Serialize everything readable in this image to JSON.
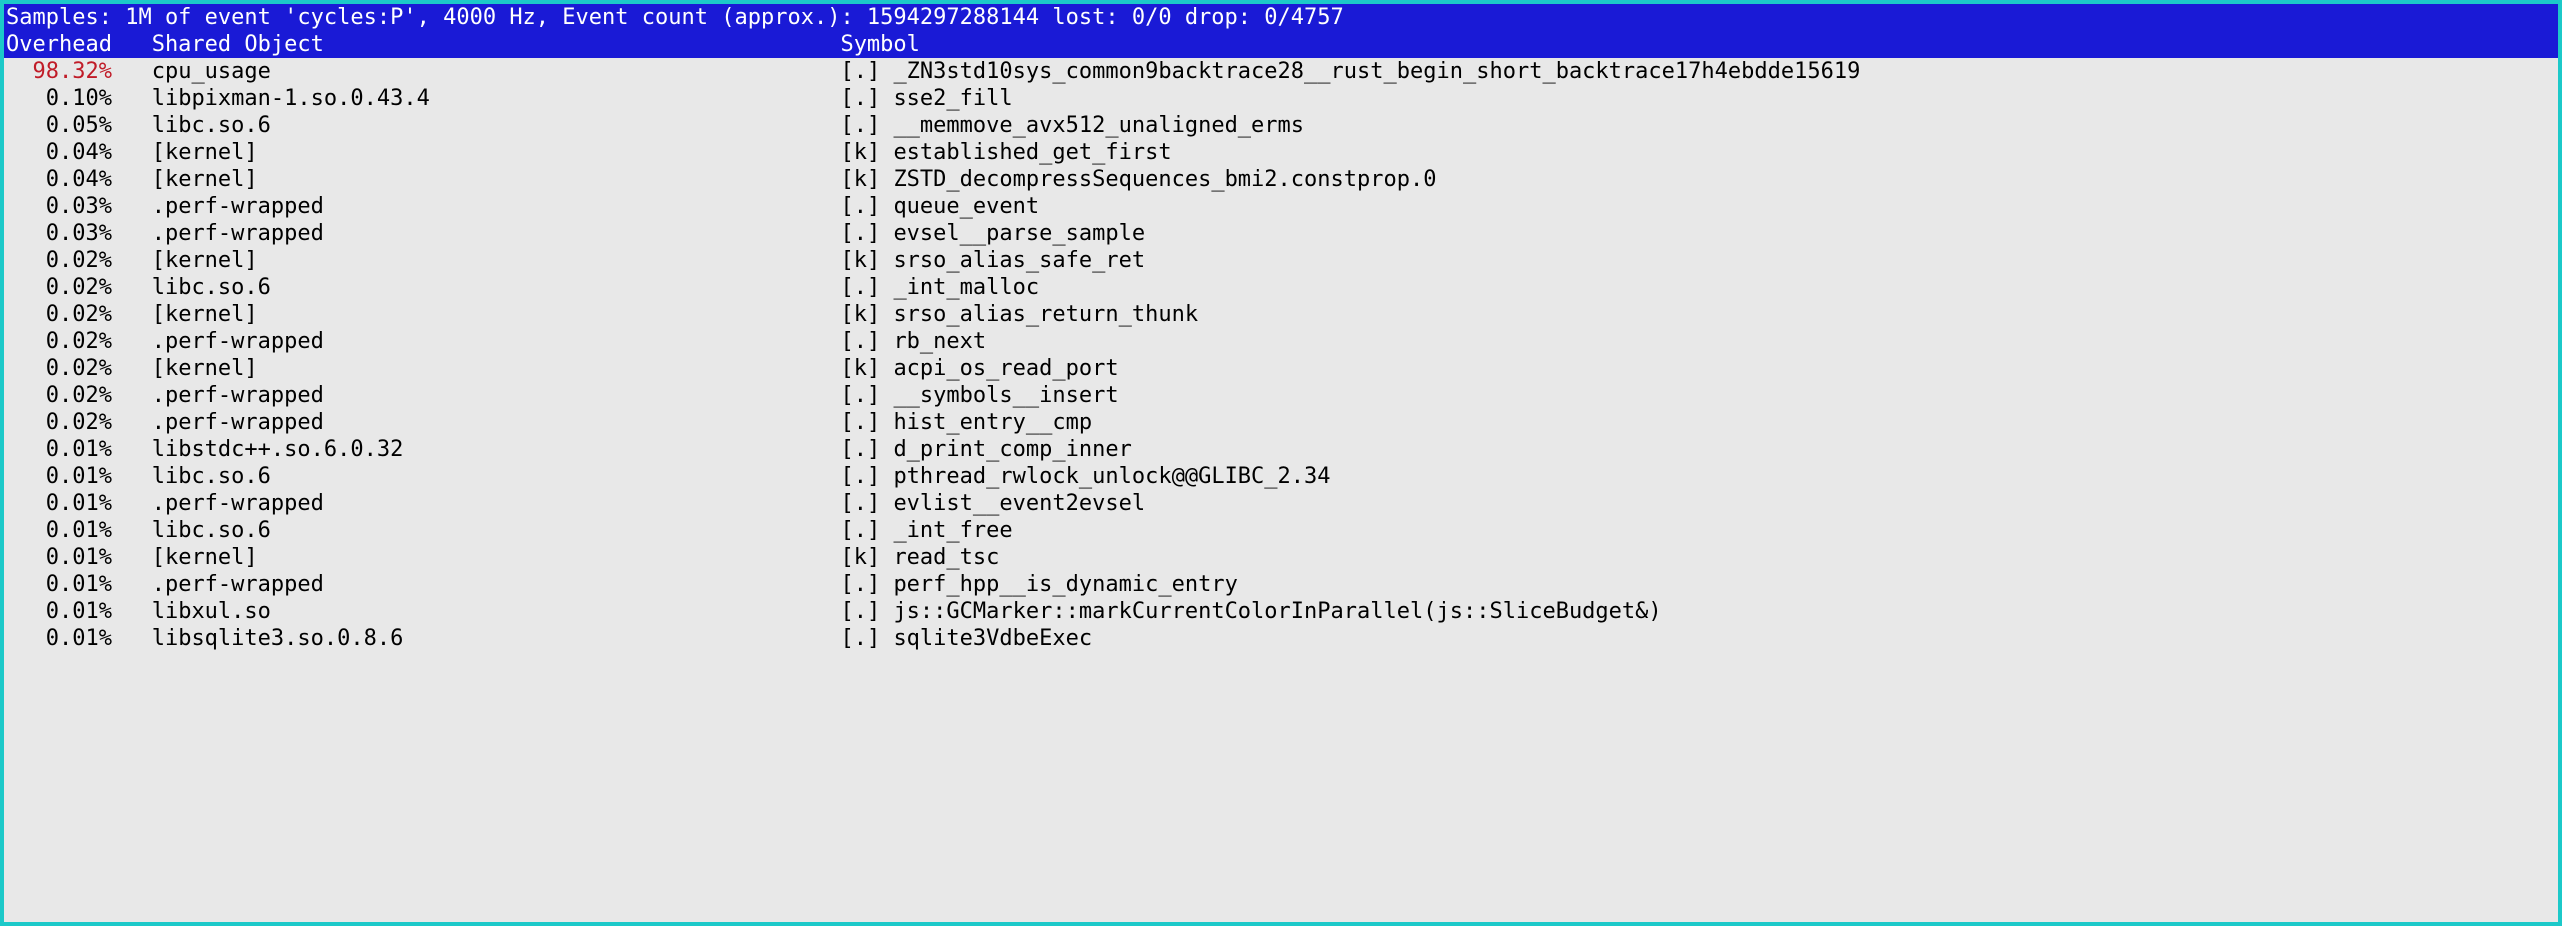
{
  "header": {
    "samples_line": "Samples: 1M of event 'cycles:P', 4000 Hz, Event count (approx.): 1594297288144 lost: 0/0 drop: 0/4757",
    "col_overhead": "Overhead",
    "col_shared": "Shared Object",
    "col_symbol": "Symbol"
  },
  "rows": [
    {
      "overhead": "98.32%",
      "hot": true,
      "shared": "cpu_usage",
      "tag": "[.]",
      "symbol": "_ZN3std10sys_common9backtrace28__rust_begin_short_backtrace17h4ebdde15619"
    },
    {
      "overhead": "0.10%",
      "hot": false,
      "shared": "libpixman-1.so.0.43.4",
      "tag": "[.]",
      "symbol": "sse2_fill"
    },
    {
      "overhead": "0.05%",
      "hot": false,
      "shared": "libc.so.6",
      "tag": "[.]",
      "symbol": "__memmove_avx512_unaligned_erms"
    },
    {
      "overhead": "0.04%",
      "hot": false,
      "shared": "[kernel]",
      "tag": "[k]",
      "symbol": "established_get_first"
    },
    {
      "overhead": "0.04%",
      "hot": false,
      "shared": "[kernel]",
      "tag": "[k]",
      "symbol": "ZSTD_decompressSequences_bmi2.constprop.0"
    },
    {
      "overhead": "0.03%",
      "hot": false,
      "shared": ".perf-wrapped",
      "tag": "[.]",
      "symbol": "queue_event"
    },
    {
      "overhead": "0.03%",
      "hot": false,
      "shared": ".perf-wrapped",
      "tag": "[.]",
      "symbol": "evsel__parse_sample"
    },
    {
      "overhead": "0.02%",
      "hot": false,
      "shared": "[kernel]",
      "tag": "[k]",
      "symbol": "srso_alias_safe_ret"
    },
    {
      "overhead": "0.02%",
      "hot": false,
      "shared": "libc.so.6",
      "tag": "[.]",
      "symbol": "_int_malloc"
    },
    {
      "overhead": "0.02%",
      "hot": false,
      "shared": "[kernel]",
      "tag": "[k]",
      "symbol": "srso_alias_return_thunk"
    },
    {
      "overhead": "0.02%",
      "hot": false,
      "shared": ".perf-wrapped",
      "tag": "[.]",
      "symbol": "rb_next"
    },
    {
      "overhead": "0.02%",
      "hot": false,
      "shared": "[kernel]",
      "tag": "[k]",
      "symbol": "acpi_os_read_port"
    },
    {
      "overhead": "0.02%",
      "hot": false,
      "shared": ".perf-wrapped",
      "tag": "[.]",
      "symbol": "__symbols__insert"
    },
    {
      "overhead": "0.02%",
      "hot": false,
      "shared": ".perf-wrapped",
      "tag": "[.]",
      "symbol": "hist_entry__cmp"
    },
    {
      "overhead": "0.01%",
      "hot": false,
      "shared": "libstdc++.so.6.0.32",
      "tag": "[.]",
      "symbol": "d_print_comp_inner"
    },
    {
      "overhead": "0.01%",
      "hot": false,
      "shared": "libc.so.6",
      "tag": "[.]",
      "symbol": "pthread_rwlock_unlock@@GLIBC_2.34"
    },
    {
      "overhead": "0.01%",
      "hot": false,
      "shared": ".perf-wrapped",
      "tag": "[.]",
      "symbol": "evlist__event2evsel"
    },
    {
      "overhead": "0.01%",
      "hot": false,
      "shared": "libc.so.6",
      "tag": "[.]",
      "symbol": "_int_free"
    },
    {
      "overhead": "0.01%",
      "hot": false,
      "shared": "[kernel]",
      "tag": "[k]",
      "symbol": "read_tsc"
    },
    {
      "overhead": "0.01%",
      "hot": false,
      "shared": ".perf-wrapped",
      "tag": "[.]",
      "symbol": "perf_hpp__is_dynamic_entry"
    },
    {
      "overhead": "0.01%",
      "hot": false,
      "shared": "libxul.so",
      "tag": "[.]",
      "symbol": "js::GCMarker::markCurrentColorInParallel(js::SliceBudget&)"
    },
    {
      "overhead": "0.01%",
      "hot": false,
      "shared": "libsqlite3.so.0.8.6",
      "tag": "[.]",
      "symbol": "sqlite3VdbeExec"
    }
  ],
  "layout": {
    "shared_col_start": 11,
    "symbol_col_start": 63
  }
}
